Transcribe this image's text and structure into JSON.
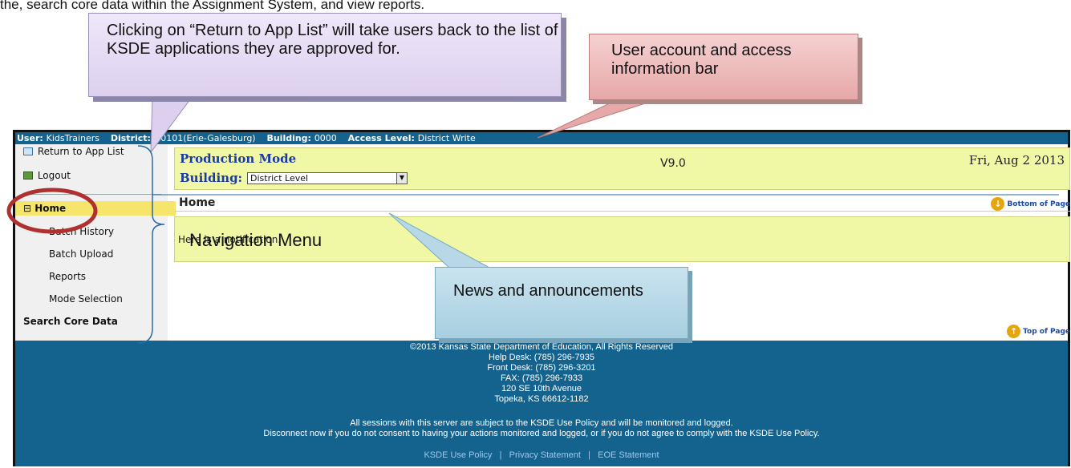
{
  "document_intro": "the, search core data within the Assignment System, and view reports.",
  "callouts": {
    "return_to_app_list": "Clicking on “Return to App List” will take users back to the list of KSDE applications they are approved for.",
    "user_account_bar": "User account and access information bar",
    "navigation_menu": "Navigation Menu",
    "news_announcements": "News and announcements"
  },
  "topbar": {
    "user_label": "User:",
    "user_value": "KidsTrainers",
    "district_label": "District:",
    "district_value": "D0101(Erie-Galesburg)",
    "building_label": "Building:",
    "building_value": "0000",
    "access_label": "Access Level:",
    "access_value": "District Write"
  },
  "sidebar": {
    "return_label": "Return to App List",
    "logout_label": "Logout",
    "home_toggle": "⊟",
    "home_label": "Home",
    "items": [
      "Batch History",
      "Batch Upload",
      "Reports",
      "Mode Selection"
    ],
    "search_label": "Search Core Data"
  },
  "header": {
    "mode": "Production Mode",
    "building_label": "Building:",
    "building_selected": "District Level",
    "version": "V9.0",
    "date": "Fri, Aug 2 2013"
  },
  "main": {
    "page_title": "Home",
    "bottom_link": "Bottom of Page",
    "top_link": "Top of Page",
    "notification": "Here is a notification."
  },
  "footer": {
    "copyright": "©2013 Kansas State Department of Education, All Rights Reserved",
    "help_desk": "Help Desk: (785) 296-7935",
    "front_desk": "Front Desk: (785) 296-3201",
    "fax": "FAX: (785) 296-7933",
    "address1": "120 SE 10th Avenue",
    "address2": "Topeka, KS 66612-1182",
    "policy_note1": "All sessions with this server are subject to the KSDE Use Policy and will be monitored and logged.",
    "policy_note2": "Disconnect now if you do not consent to having your actions monitored and logged, or if you do not agree to comply with the KSDE Use Policy.",
    "link_use_policy": "KSDE Use Policy",
    "link_privacy": "Privacy Statement",
    "link_eoe": "EOE Statement",
    "link_sep": "|"
  },
  "colors": {
    "accent_blue": "#14638f",
    "highlight_yellow": "#f0f7a5",
    "home_highlight": "#f5e56a",
    "annotation_circle": "#b03030"
  }
}
